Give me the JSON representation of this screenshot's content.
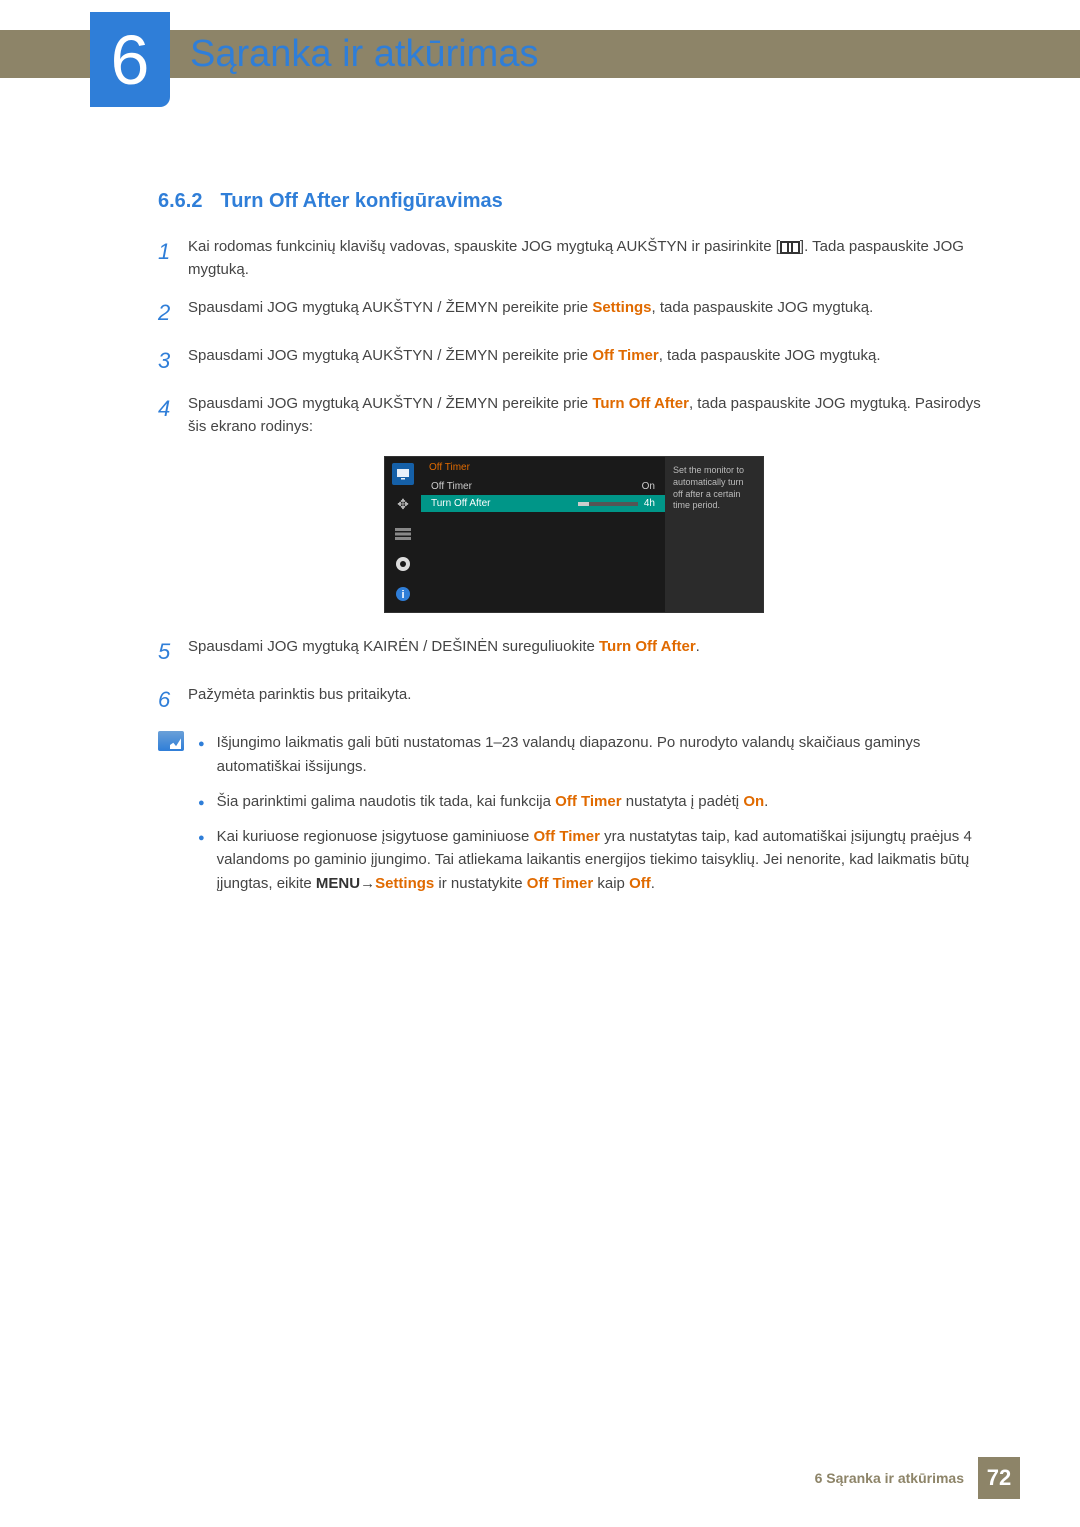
{
  "chapter": {
    "number": "6",
    "title": "Sąranka ir atkūrimas"
  },
  "section": {
    "number": "6.6.2",
    "title": "Turn Off After konfigūravimas"
  },
  "steps": [
    {
      "n": "1",
      "pre": "Kai rodomas funkcinių klavišų vadovas, spauskite JOG mygtuką AUKŠTYN ir pasirinkite [",
      "post": "]. Tada paspauskite JOG mygtuką."
    },
    {
      "n": "2",
      "t1": "Spausdami JOG mygtuką AUKŠTYN / ŽEMYN pereikite prie ",
      "hl": "Settings",
      "t2": ", tada paspauskite JOG mygtuką."
    },
    {
      "n": "3",
      "t1": "Spausdami JOG mygtuką AUKŠTYN / ŽEMYN pereikite prie ",
      "hl": "Off Timer",
      "t2": ", tada paspauskite JOG mygtuką."
    },
    {
      "n": "4",
      "t1": "Spausdami JOG mygtuką AUKŠTYN / ŽEMYN pereikite prie ",
      "hl": "Turn Off After",
      "t2": ", tada paspauskite JOG mygtuką. Pasirodys šis ekrano rodinys:"
    },
    {
      "n": "5",
      "t1": "Spausdami JOG mygtuką KAIRĖN / DEŠINĖN sureguliuokite ",
      "hl": "Turn Off After",
      "t2": "."
    },
    {
      "n": "6",
      "t1": "Pažymėta parinktis bus pritaikyta."
    }
  ],
  "osd": {
    "header": "Off Timer",
    "row1": {
      "label": "Off Timer",
      "value": "On"
    },
    "row2": {
      "label": "Turn Off After",
      "value": "4h"
    },
    "tip": "Set the monitor to automatically turn off after a certain time period."
  },
  "notes": {
    "n1": "Išjungimo laikmatis gali būti nustatomas 1–23 valandų diapazonu. Po nurodyto valandų skaičiaus gaminys automatiškai išsijungs.",
    "n2": {
      "a": "Šia parinktimi galima naudotis tik tada, kai funkcija ",
      "hl1": "Off Timer",
      "b": " nustatyta į padėtį ",
      "hl2": "On",
      "c": "."
    },
    "n3": {
      "a": "Kai kuriuose regionuose įsigytuose gaminiuose ",
      "hl1": "Off Timer",
      "b": " yra nustatytas taip, kad automatiškai įsijungtų praėjus 4 valandoms po gaminio įjungimo. Tai atliekama laikantis energijos tiekimo taisyklių. Jei nenorite, kad laikmatis būtų įjungtas, eikite ",
      "menu": "MENU",
      "arrow": " → ",
      "hl2": "Settings",
      "c": " ir nustatykite ",
      "hl3": "Off Timer",
      "d": " kaip ",
      "hl4": "Off",
      "e": "."
    }
  },
  "footer": {
    "text": "6 Sąranka ir atkūrimas",
    "page": "72"
  }
}
